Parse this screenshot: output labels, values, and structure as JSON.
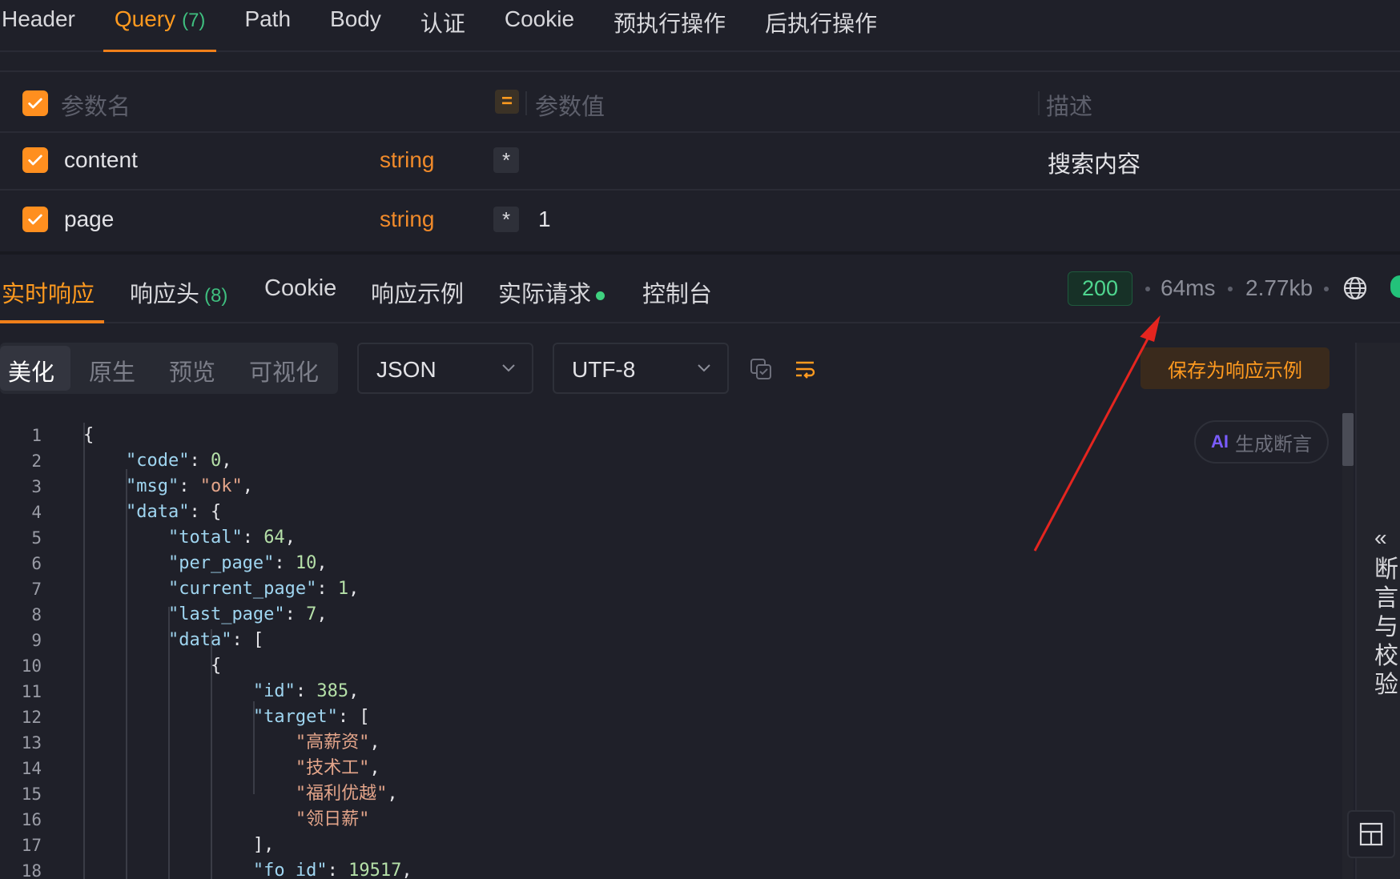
{
  "request_tabs": [
    {
      "label": "Header",
      "count": ""
    },
    {
      "label": "Query",
      "count": "(7)"
    },
    {
      "label": "Path",
      "count": ""
    },
    {
      "label": "Body",
      "count": ""
    },
    {
      "label": "认证",
      "count": ""
    },
    {
      "label": "Cookie",
      "count": ""
    },
    {
      "label": "预执行操作",
      "count": ""
    },
    {
      "label": "后执行操作",
      "count": ""
    }
  ],
  "params": {
    "header": {
      "name_placeholder": "参数名",
      "eq": "=",
      "value_placeholder": "参数值",
      "desc_placeholder": "描述"
    },
    "rows": [
      {
        "name": "content",
        "type": "string",
        "required": "*",
        "value": "",
        "desc": "搜索内容"
      },
      {
        "name": "page",
        "type": "string",
        "required": "*",
        "value": "1",
        "desc": ""
      }
    ]
  },
  "response_tabs": [
    {
      "label": "实时响应",
      "count": ""
    },
    {
      "label": "响应头",
      "count": "(8)"
    },
    {
      "label": "Cookie",
      "count": ""
    },
    {
      "label": "响应示例",
      "count": ""
    },
    {
      "label": "实际请求",
      "count": ""
    },
    {
      "label": "控制台",
      "count": ""
    }
  ],
  "status": {
    "code": "200",
    "time": "64ms",
    "size": "2.77kb"
  },
  "view_modes": [
    "美化",
    "原生",
    "预览",
    "可视化"
  ],
  "format_select": "JSON",
  "encoding_select": "UTF-8",
  "save_button": "保存为响应示例",
  "ai_button": {
    "badge": "AI",
    "label": "生成断言"
  },
  "side_panel": {
    "chevron": "«",
    "label": "断言与校验"
  },
  "code_lines": [
    {
      "n": "1",
      "t": "{"
    },
    {
      "n": "2",
      "t": "    \"code\": 0,"
    },
    {
      "n": "3",
      "t": "    \"msg\": \"ok\","
    },
    {
      "n": "4",
      "t": "    \"data\": {"
    },
    {
      "n": "5",
      "t": "        \"total\": 64,"
    },
    {
      "n": "6",
      "t": "        \"per_page\": 10,"
    },
    {
      "n": "7",
      "t": "        \"current_page\": 1,"
    },
    {
      "n": "8",
      "t": "        \"last_page\": 7,"
    },
    {
      "n": "9",
      "t": "        \"data\": ["
    },
    {
      "n": "10",
      "t": "            {"
    },
    {
      "n": "11",
      "t": "                \"id\": 385,"
    },
    {
      "n": "12",
      "t": "                \"target\": ["
    },
    {
      "n": "13",
      "t": "                    \"高薪资\","
    },
    {
      "n": "14",
      "t": "                    \"技术工\","
    },
    {
      "n": "15",
      "t": "                    \"福利优越\","
    },
    {
      "n": "16",
      "t": "                    \"领日薪\""
    },
    {
      "n": "17",
      "t": "                ],"
    },
    {
      "n": "18",
      "t": "                \"fo_id\": 19517,"
    }
  ],
  "colors": {
    "accent": "#ff9a1f",
    "success": "#4fd68f",
    "annotation_arrow": "#e5251f"
  }
}
